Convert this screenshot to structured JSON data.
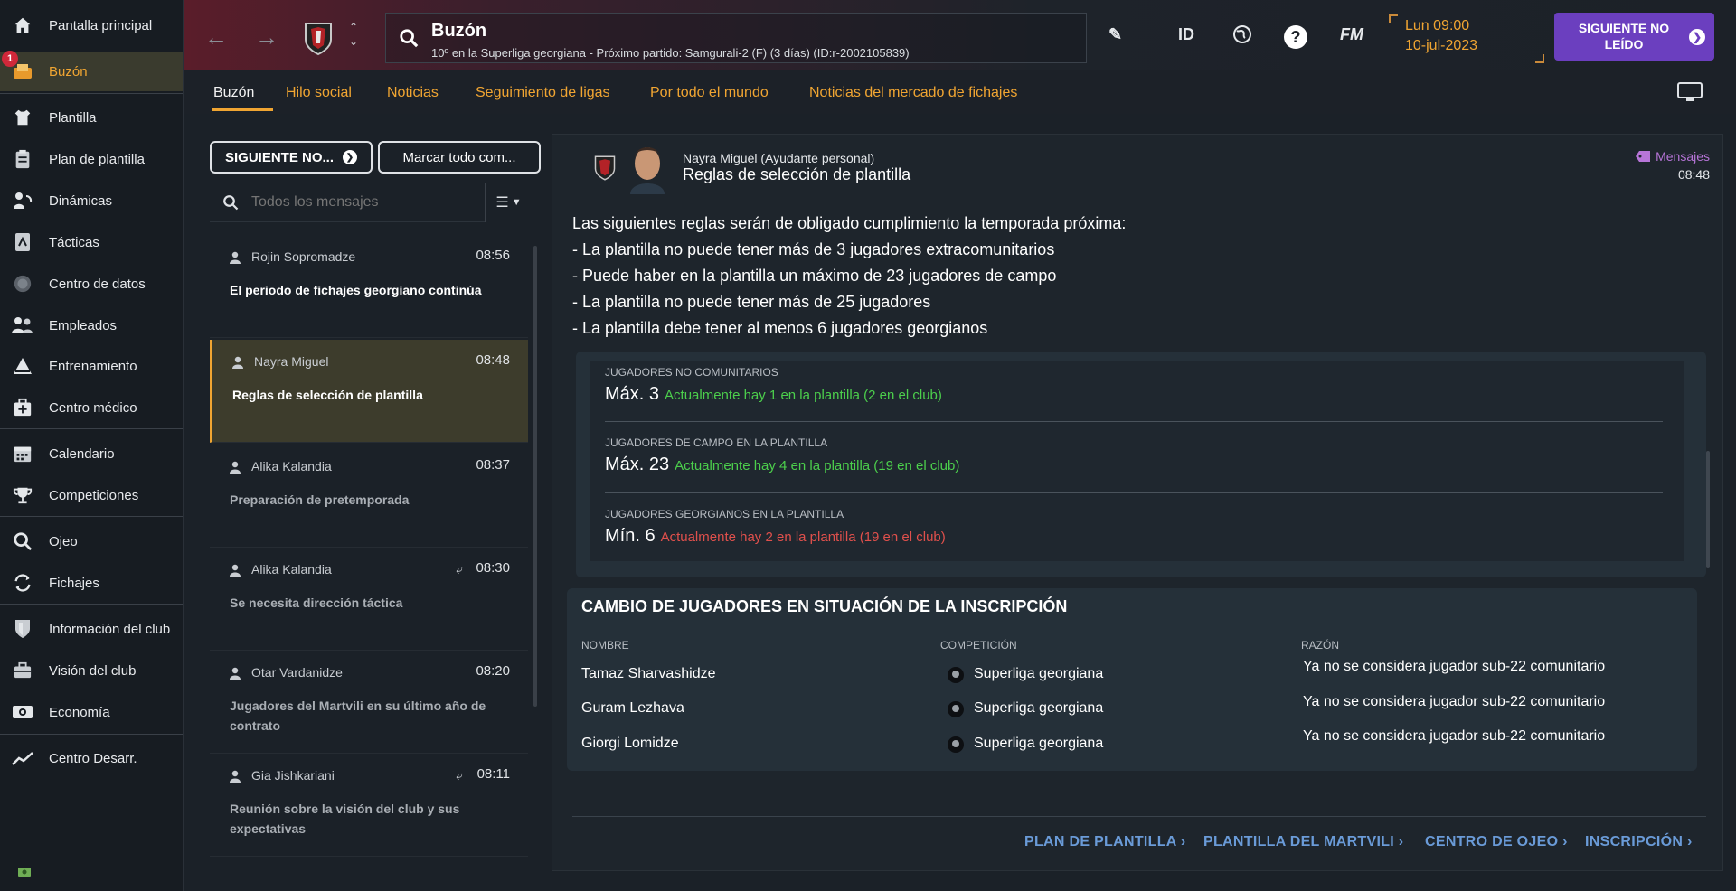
{
  "sidebar": {
    "badge": "1",
    "items": [
      {
        "label": "Pantalla principal",
        "icon": "home-icon"
      },
      {
        "label": "Buzón",
        "icon": "inbox-icon"
      },
      {
        "label": "Plantilla",
        "icon": "shirt-icon"
      },
      {
        "label": "Plan de plantilla",
        "icon": "clipboard-icon"
      },
      {
        "label": "Dinámicas",
        "icon": "dynamics-icon"
      },
      {
        "label": "Tácticas",
        "icon": "tactics-icon"
      },
      {
        "label": "Centro de datos",
        "icon": "data-icon"
      },
      {
        "label": "Empleados",
        "icon": "staff-icon"
      },
      {
        "label": "Entrenamiento",
        "icon": "training-icon"
      },
      {
        "label": "Centro médico",
        "icon": "medical-icon"
      },
      {
        "label": "Calendario",
        "icon": "calendar-icon"
      },
      {
        "label": "Competiciones",
        "icon": "trophy-icon"
      },
      {
        "label": "Ojeo",
        "icon": "scouting-icon"
      },
      {
        "label": "Fichajes",
        "icon": "transfers-icon"
      },
      {
        "label": "Información del club",
        "icon": "club-info-icon"
      },
      {
        "label": "Visión del club",
        "icon": "club-vision-icon"
      },
      {
        "label": "Economía",
        "icon": "finance-icon"
      },
      {
        "label": "Centro Desarr.",
        "icon": "development-icon"
      }
    ]
  },
  "header": {
    "title": "Buzón",
    "subtitle": "10º en la Superliga georgiana - Próximo partido: Samgurali-2 (F) (3 días) (ID:r-2002105839)",
    "id_label": "ID",
    "fm_label": "FM",
    "help_label": "?",
    "day_time": "Lun 09:00",
    "date": "10-jul-2023",
    "next_unread": "SIGUIENTE NO LEÍDO"
  },
  "tabs": [
    {
      "label": "Buzón"
    },
    {
      "label": "Hilo social"
    },
    {
      "label": "Noticias"
    },
    {
      "label": "Seguimiento de ligas"
    },
    {
      "label": "Por todo el mundo"
    },
    {
      "label": "Noticias del mercado de fichajes"
    }
  ],
  "list": {
    "next_button": "SIGUIENTE NO...",
    "mark_all_button": "Marcar todo com...",
    "search_placeholder": "Todos los mensajes",
    "messages": [
      {
        "sender": "Rojin Sopromadze",
        "time": "08:56",
        "subject": "El periodo de fichajes georgiano continúa",
        "read": false,
        "replied": false
      },
      {
        "sender": "Nayra Miguel",
        "time": "08:48",
        "subject": "Reglas de selección de plantilla",
        "read": false,
        "replied": false
      },
      {
        "sender": "Alika Kalandia",
        "time": "08:37",
        "subject": "Preparación de pretemporada",
        "read": true,
        "replied": false
      },
      {
        "sender": "Alika Kalandia",
        "time": "08:30",
        "subject": "Se necesita dirección táctica",
        "read": true,
        "replied": true
      },
      {
        "sender": "Otar Vardanidze",
        "time": "08:20",
        "subject": "Jugadores del Martvili en su último año de contrato",
        "read": true,
        "replied": false
      },
      {
        "sender": "Gia Jishkariani",
        "time": "08:11",
        "subject": "Reunión sobre la visión del club y sus expectativas",
        "read": true,
        "replied": true
      }
    ]
  },
  "message": {
    "sender": "Nayra Miguel  (Ayudante personal)",
    "subject": "Reglas de selección de plantilla",
    "tag": "Mensajes",
    "time": "08:48",
    "body": [
      "Las siguientes reglas serán de obligado cumplimiento la temporada próxima:",
      "- La plantilla no puede tener más de 3 jugadores extracomunitarios",
      "- Puede haber en la plantilla un máximo de 23 jugadores de campo",
      "- La plantilla no puede tener más de 25 jugadores",
      "- La plantilla debe tener al menos 6 jugadores georgianos"
    ],
    "rules": [
      {
        "label": "JUGADORES NO COMUNITARIOS",
        "value": "Máx. 3",
        "status": "Actualmente hay 1 en la plantilla (2 en el club)",
        "ok": true
      },
      {
        "label": "JUGADORES DE CAMPO EN LA PLANTILLA",
        "value": "Máx. 23",
        "status": "Actualmente hay 4 en la plantilla (19 en el club)",
        "ok": true
      },
      {
        "label": "JUGADORES GEORGIANOS EN LA PLANTILLA",
        "value": "Mín. 6",
        "status": "Actualmente hay 2 en la plantilla (19 en el club)",
        "ok": false
      }
    ],
    "changes": {
      "title": "CAMBIO DE JUGADORES EN SITUACIÓN DE LA INSCRIPCIÓN",
      "col_name": "NOMBRE",
      "col_competition": "COMPETICIÓN",
      "col_reason": "RAZÓN",
      "rows": [
        {
          "name": "Tamaz Sharvashidze",
          "competition": "Superliga georgiana",
          "reason": "Ya no se considera jugador sub-22 comunitario"
        },
        {
          "name": "Guram Lezhava",
          "competition": "Superliga georgiana",
          "reason": "Ya no se considera jugador sub-22 comunitario"
        },
        {
          "name": "Giorgi Lomidze",
          "competition": "Superliga georgiana",
          "reason": "Ya no se considera jugador sub-22 comunitario"
        }
      ]
    },
    "links": [
      {
        "label": "PLAN DE PLANTILLA"
      },
      {
        "label": "PLANTILLA DEL MARTVILI"
      },
      {
        "label": "CENTRO DE OJEO"
      },
      {
        "label": "INSCRIPCIÓN"
      }
    ]
  },
  "colors": {
    "accent": "#f0a532",
    "purple": "#6b3fbf",
    "ok": "#4ccf4c",
    "bad": "#e0504c",
    "link": "#6a9bd8"
  }
}
